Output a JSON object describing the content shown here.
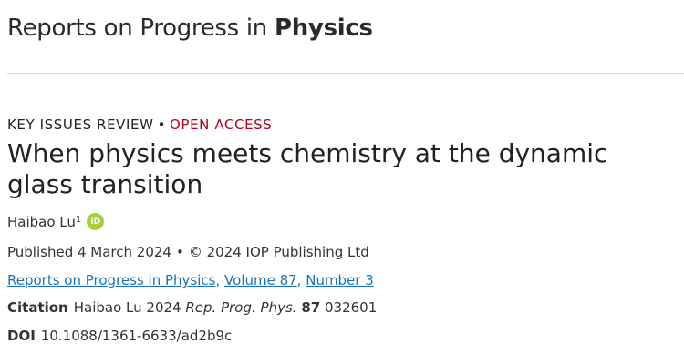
{
  "header": {
    "journal_name_regular": "Reports on Progress in ",
    "journal_name_bold": "Physics"
  },
  "article": {
    "type": "KEY ISSUES REVIEW",
    "separator": "•",
    "access": "OPEN ACCESS",
    "title": "When physics meets chemistry at the dynamic glass transition",
    "author": "Haibao Lu",
    "author_affiliation": "1",
    "orcid_icon_text": "iD",
    "published": "Published 4 March 2024",
    "copyright": "© 2024 IOP Publishing Ltd",
    "breadcrumbs": {
      "journal": "Reports on Progress in Physics",
      "volume": "Volume 87",
      "issue": "Number 3"
    },
    "citation": {
      "label": "Citation",
      "authors_year": "Haibao Lu 2024",
      "journal_abbrev": "Rep. Prog. Phys.",
      "volume": "87",
      "article_number": "032601"
    },
    "doi": {
      "label": "DOI",
      "value": "10.1088/1361-6633/ad2b9c"
    }
  },
  "colors": {
    "open_access": "#b00020",
    "link": "#1a73b8",
    "orcid": "#a6ce39"
  }
}
